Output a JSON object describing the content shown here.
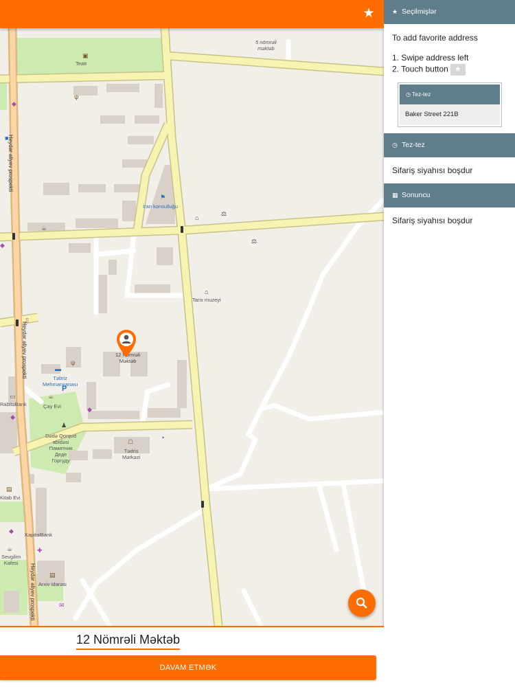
{
  "topbar": {
    "favorite_icon": "star-icon"
  },
  "map": {
    "labels": {
      "teatr": "Teatr",
      "school5": "5 nömrəli\nməktəb",
      "iran": "İran konsulluğu",
      "tarix": "Tarix muzeyi",
      "school12": "12 Nömrəli\nMəktəb",
      "tabriz": "Təbriz\nMehmanxanası",
      "rabita": "RabitəBank",
      "cay": "Çay Evi",
      "dada": "Dədə Qorqud\nabidəsi\nПамятник\nДеде\nГоргуду",
      "tedris": "Tədris\nMərkəzi",
      "kitab": "Kitab Evi",
      "kapital": "KapitalBank",
      "sevgilim": "Sevgilim\nKafesi",
      "arxiv": "Arxiv idarəsi",
      "heydar1": "Heydər əliyev prospekti",
      "heydar2": "Heydər əliyev prospekti",
      "heydar3": "Heydər əliyev prospekti"
    }
  },
  "bottom": {
    "address": "12 Nömrəli Məktəb",
    "continue_label": "DAVAM ETMƏK"
  },
  "panel": {
    "favorites": {
      "title": "Seçilmişlər",
      "icon": "star-icon",
      "hint": "To add favorite address",
      "step1": "1. Swipe address left",
      "step2": "2. Touch button",
      "demo_title": "Tez-tez",
      "demo_address": "Baker Street 221B"
    },
    "frequent": {
      "title": "Tez-tez",
      "icon": "clock-icon",
      "empty": "Sifariş siyahısı boşdur"
    },
    "recent": {
      "title": "Sonuncu",
      "icon": "calendar-icon",
      "empty": "Sifariş siyahısı boşdur"
    }
  },
  "colors": {
    "accent": "#ff6d00",
    "panel_header": "#607d8b",
    "road": "#f7f3b0",
    "park": "#cdebb0"
  }
}
